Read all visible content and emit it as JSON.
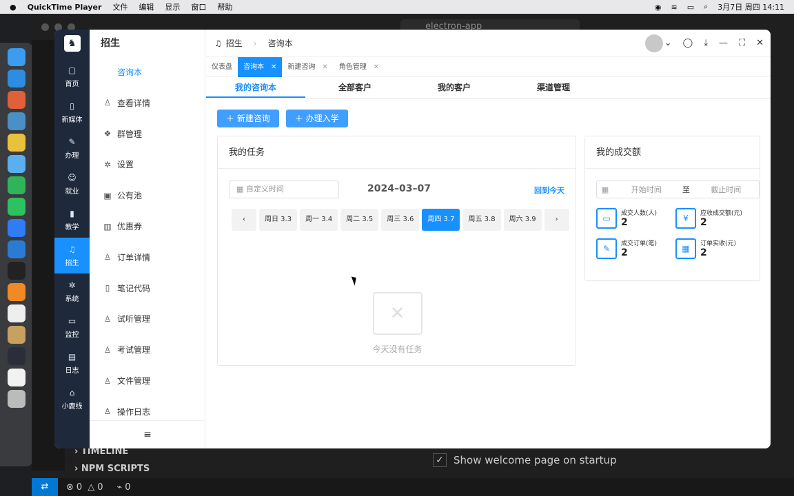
{
  "menubar": {
    "app_name": "QuickTime Player",
    "menus": [
      "文件",
      "编辑",
      "显示",
      "窗口",
      "帮助"
    ],
    "clock": "3月7日 周四  14:11"
  },
  "vscode": {
    "search": "electron-app",
    "sections": [
      "TIMELINE",
      "NPM SCRIPTS"
    ],
    "welcome": "Show welcome page on startup",
    "status": {
      "errors": "0",
      "warnings": "0",
      "ports": "0"
    }
  },
  "rail": {
    "items": [
      {
        "label": "首页",
        "icon": "home-icon"
      },
      {
        "label": "新媒体",
        "icon": "tablet-icon"
      },
      {
        "label": "办理",
        "icon": "pen-icon"
      },
      {
        "label": "就业",
        "icon": "person-icon"
      },
      {
        "label": "教学",
        "icon": "mic-icon"
      },
      {
        "label": "招生",
        "icon": "headset-icon"
      },
      {
        "label": "系统",
        "icon": "gear-icon"
      },
      {
        "label": "监控",
        "icon": "monitor-icon"
      },
      {
        "label": "日志",
        "icon": "log-icon"
      },
      {
        "label": "小鹿线",
        "icon": "house-icon"
      }
    ]
  },
  "submenu": {
    "title": "招生",
    "current": "咨询本",
    "items": [
      "查看详情",
      "群管理",
      "设置",
      "公有池",
      "优惠券",
      "订单详情",
      "笔记代码",
      "试听管理",
      "考试管理",
      "文件管理",
      "操作日志"
    ]
  },
  "breadcrumb": {
    "parent": "招生",
    "current": "咨询本"
  },
  "tags": [
    {
      "label": "仪表盘",
      "closable": false
    },
    {
      "label": "咨询本",
      "closable": true
    },
    {
      "label": "新建咨询",
      "closable": true
    },
    {
      "label": "角色管理",
      "closable": true
    }
  ],
  "tabs": [
    "我的咨询本",
    "全部客户",
    "我的客户",
    "渠道管理"
  ],
  "actions": {
    "new_consult": "新建咨询",
    "enroll": "办理入学"
  },
  "tasks": {
    "title": "我的任务",
    "date_placeholder": "自定义时间",
    "date": "2024–03–07",
    "back_today": "回到今天",
    "days": [
      "周日 3.3",
      "周一 3.4",
      "周二 3.5",
      "周三 3.6",
      "周四 3.7",
      "周五 3.8",
      "周六 3.9"
    ],
    "selected_day": "周四 3.7",
    "empty": "今天没有任务"
  },
  "deals": {
    "title": "我的成交额",
    "start": "开始时间",
    "to": "至",
    "end": "截止时间",
    "stats": [
      {
        "label": "成交人数(人)",
        "value": "2",
        "icon": "monitor-icon"
      },
      {
        "label": "应收成交额(元)",
        "value": "2",
        "icon": "cash-icon"
      },
      {
        "label": "成交订单(笔)",
        "value": "2",
        "icon": "pencil-icon"
      },
      {
        "label": "订单实收(元)",
        "value": "2",
        "icon": "calendar-icon"
      }
    ]
  }
}
